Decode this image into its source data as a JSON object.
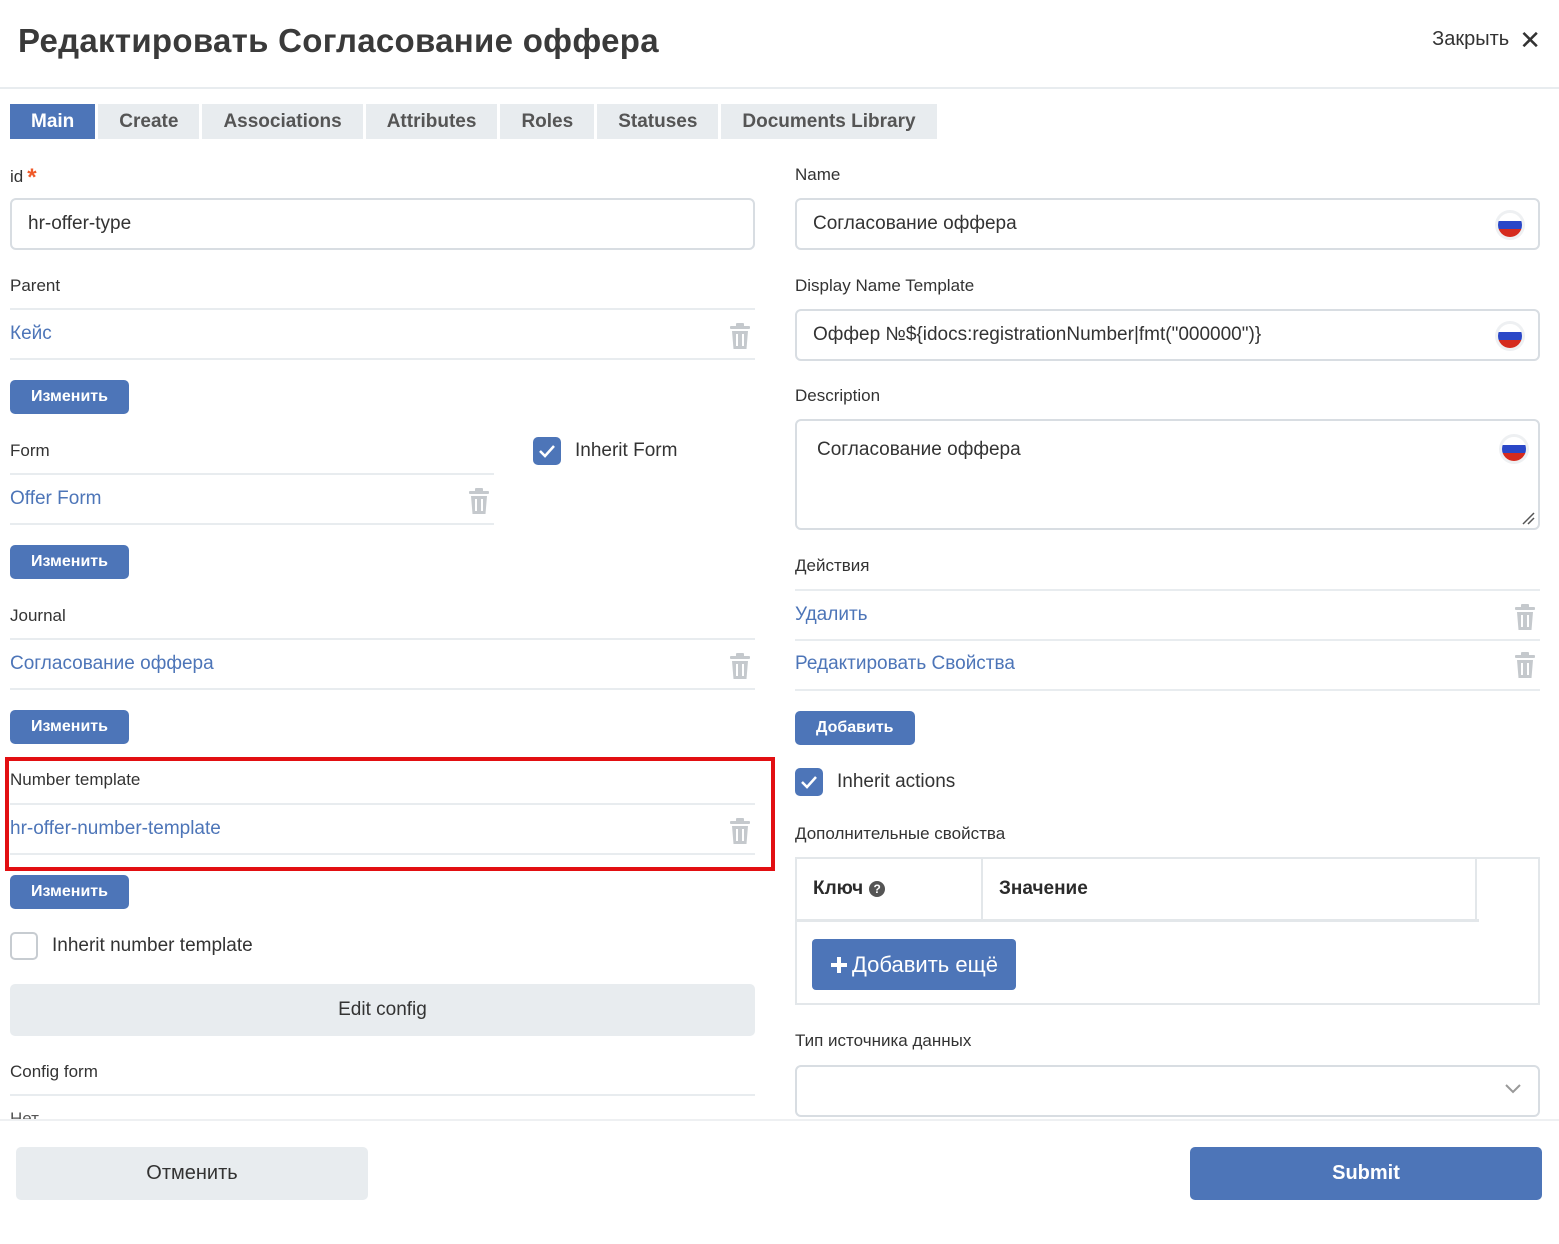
{
  "header": {
    "title": "Редактировать Согласование оффера",
    "close_label": "Закрыть"
  },
  "tabs": [
    {
      "label": "Main",
      "active": true
    },
    {
      "label": "Create"
    },
    {
      "label": "Associations"
    },
    {
      "label": "Attributes"
    },
    {
      "label": "Roles"
    },
    {
      "label": "Statuses"
    },
    {
      "label": "Documents Library"
    }
  ],
  "left": {
    "id": {
      "label": "id",
      "required_mark": "*",
      "value": "hr-offer-type"
    },
    "parent": {
      "label": "Parent",
      "value": "Кейс",
      "button": "Изменить"
    },
    "form": {
      "label": "Form",
      "value": "Offer Form",
      "button": "Изменить",
      "inherit_label": "Inherit Form",
      "inherit_checked": true
    },
    "journal": {
      "label": "Journal",
      "value": "Согласование оффера",
      "button": "Изменить"
    },
    "number_template": {
      "label": "Number template",
      "value": "hr-offer-number-template",
      "button": "Изменить",
      "inherit_label": "Inherit number template",
      "inherit_checked": false
    },
    "edit_config": "Edit config",
    "config_form": {
      "label": "Config form",
      "value": "Нет"
    }
  },
  "right": {
    "name": {
      "label": "Name",
      "value": "Согласование оффера"
    },
    "display_name_template": {
      "label": "Display Name Template",
      "value": "Оффер №${idocs:registrationNumber|fmt(\"000000\")}"
    },
    "description": {
      "label": "Description",
      "value": "Согласование оффера"
    },
    "actions": {
      "label": "Действия",
      "items": [
        "Удалить",
        "Редактировать Свойства"
      ],
      "add_button": "Добавить",
      "inherit_label": "Inherit actions",
      "inherit_checked": true
    },
    "extra_props": {
      "label": "Дополнительные свойства",
      "key_header": "Ключ",
      "value_header": "Значение",
      "add_more": "Добавить ещё"
    },
    "data_source": {
      "label": "Тип источника данных",
      "value": ""
    }
  },
  "footer": {
    "cancel": "Отменить",
    "submit": "Submit"
  },
  "colors": {
    "primary": "#4d75b8",
    "highlight": "#e20f12",
    "required": "#ef5a2a",
    "tab_bg": "#e8ecef"
  },
  "icons": {
    "trash": "trash-icon",
    "close": "close-icon",
    "check": "check-icon",
    "flag": "ru-flag-icon",
    "chevron": "chevron-down-icon",
    "help": "help-icon",
    "plus": "plus-icon"
  }
}
